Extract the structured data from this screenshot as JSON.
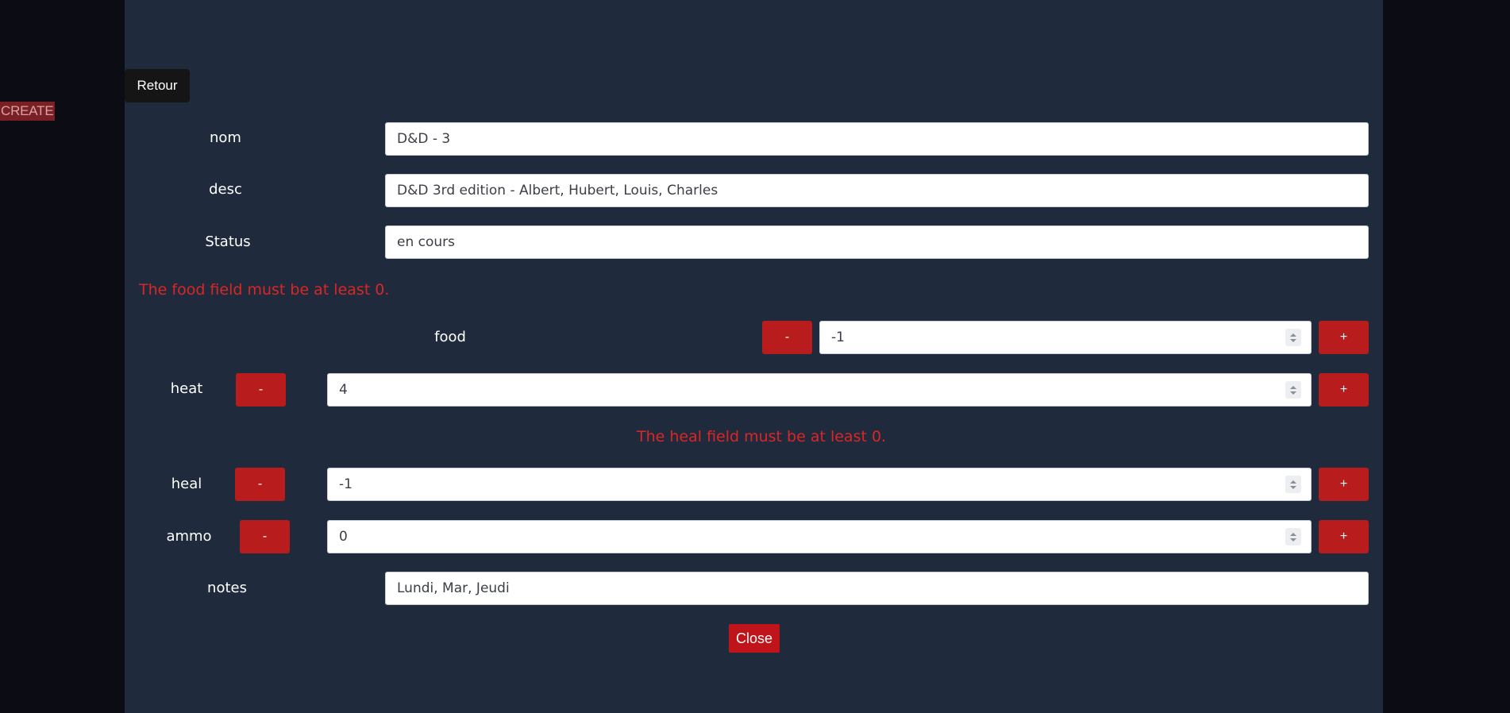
{
  "side": {
    "create_label": "CREATE"
  },
  "modal": {
    "back_label": "Retour",
    "fields": {
      "nom": {
        "label": "nom",
        "value": "D&D - 3"
      },
      "desc": {
        "label": "desc",
        "value": "D&D 3rd edition - Albert, Hubert, Louis, Charles"
      },
      "status": {
        "label": "Status",
        "value": "en cours"
      },
      "notes": {
        "label": "notes",
        "value": "Lundi, Mar, Jeudi"
      }
    },
    "errors": {
      "food": "The food field must be at least 0.",
      "heal": "The heal field must be at least 0."
    },
    "counters": {
      "food": {
        "label": "food",
        "value": "-1",
        "minus": "-",
        "plus": "+"
      },
      "heat": {
        "label": "heat",
        "value": "4",
        "minus": "-",
        "plus": "+"
      },
      "heal": {
        "label": "heal",
        "value": "-1",
        "minus": "-",
        "plus": "+"
      },
      "ammo": {
        "label": "ammo",
        "value": "0",
        "minus": "-",
        "plus": "+"
      }
    },
    "close_label": "Close"
  },
  "colors": {
    "background": "#0c0d14",
    "modal": "#1f2a3c",
    "accent_red": "#b91c1c",
    "error_red": "#dc2626"
  }
}
